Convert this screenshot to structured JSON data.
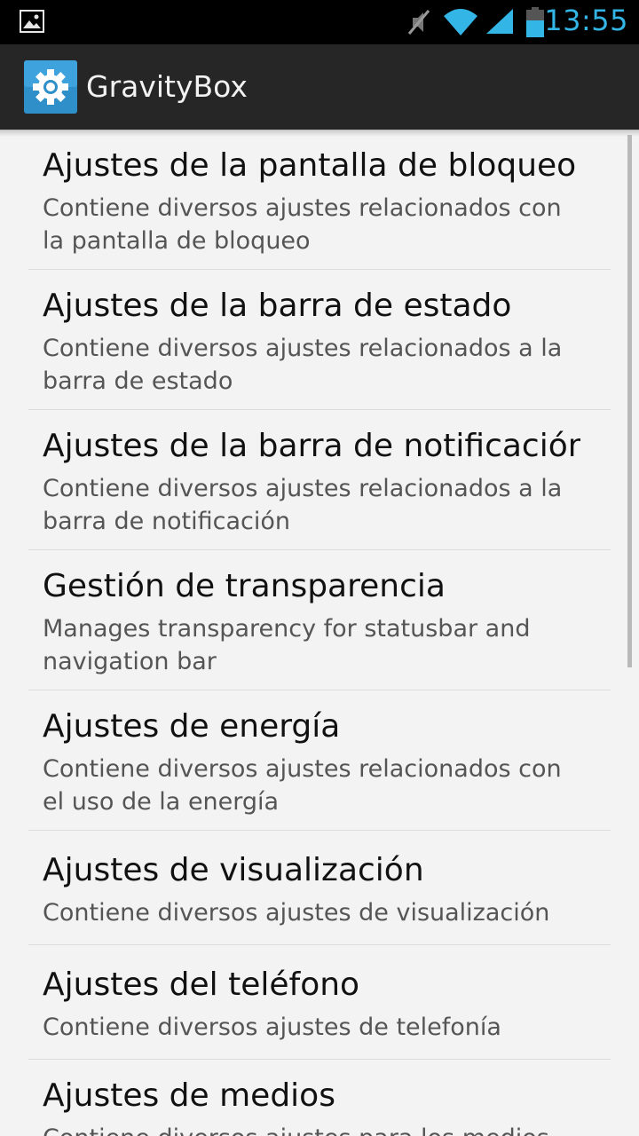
{
  "status_bar": {
    "time": "13:55",
    "icons": [
      "image-icon",
      "mute-icon",
      "wifi-icon",
      "signal-icon",
      "battery-icon"
    ],
    "accent_color": "#33b5e5"
  },
  "action_bar": {
    "title": "GravityBox",
    "icon": "settings-gear-icon"
  },
  "list": {
    "items": [
      {
        "title": "Ajustes de la pantalla de bloqueo",
        "summary": "Contiene diversos ajustes relacionados con la pantalla de bloqueo"
      },
      {
        "title": "Ajustes de la barra de estado",
        "summary": "Contiene diversos ajustes relacionados a la barra de estado"
      },
      {
        "title": "Ajustes de la barra de notificación",
        "summary": "Contiene diversos ajustes relacionados a la barra de notificación"
      },
      {
        "title": "Gestión de transparencia",
        "summary": "Manages transparency for statusbar and navigation bar"
      },
      {
        "title": "Ajustes de energía",
        "summary": "Contiene diversos ajustes relacionados con el uso de la energía"
      },
      {
        "title": "Ajustes de visualización",
        "summary": "Contiene diversos ajustes de visualización"
      },
      {
        "title": "Ajustes del teléfono",
        "summary": "Contiene diversos ajustes de telefonía"
      },
      {
        "title": "Ajustes de medios",
        "summary": "Contiene diversos ajustes para los medios"
      }
    ]
  }
}
